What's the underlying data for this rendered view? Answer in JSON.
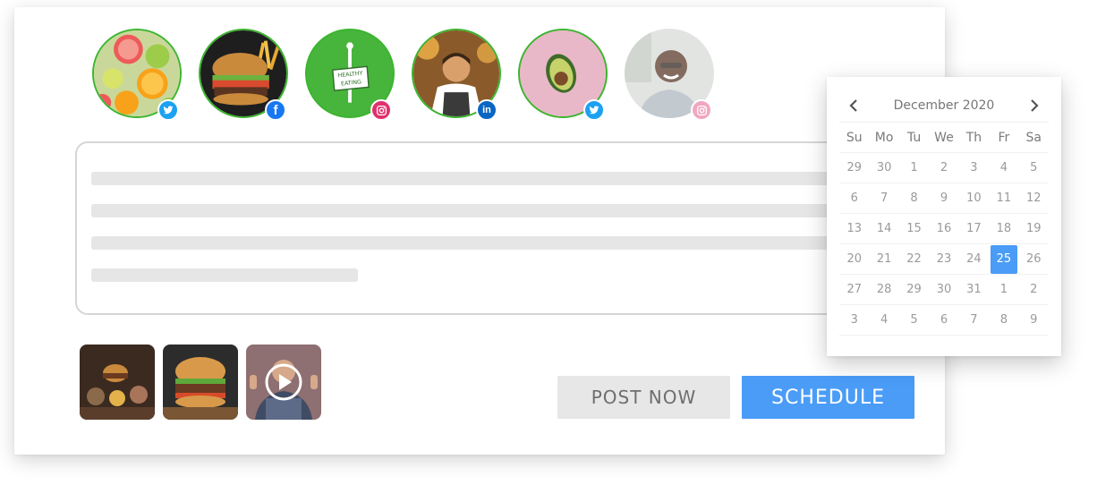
{
  "profiles": [
    {
      "subject": "citrus fruits",
      "network": "twitter-icon",
      "selected": true
    },
    {
      "subject": "burger and fries",
      "network": "facebook-icon",
      "selected": true
    },
    {
      "subject": "healthy eating logo",
      "network": "instagram-icon",
      "selected": true,
      "logo_text": "HEALTHY EATING"
    },
    {
      "subject": "chef portrait",
      "network": "linkedin-icon",
      "selected": true
    },
    {
      "subject": "avocado",
      "network": "twitter-icon",
      "selected": true
    },
    {
      "subject": "smiling man",
      "network": "instagram-icon",
      "selected": false
    }
  ],
  "media": [
    {
      "subject": "burger and fries on table"
    },
    {
      "subject": "burger close-up"
    },
    {
      "subject": "video of man giving thumbs up",
      "has_play_icon": true
    }
  ],
  "actions": {
    "post_now": "POST NOW",
    "schedule": "SCHEDULE"
  },
  "calendar": {
    "month_label": "December 2020",
    "weekdays": [
      "Su",
      "Mo",
      "Tu",
      "We",
      "Th",
      "Fr",
      "Sa"
    ],
    "weeks": [
      [
        "29",
        "30",
        "1",
        "2",
        "3",
        "4",
        "5"
      ],
      [
        "6",
        "7",
        "8",
        "9",
        "10",
        "11",
        "12"
      ],
      [
        "13",
        "14",
        "15",
        "16",
        "17",
        "18",
        "19"
      ],
      [
        "20",
        "21",
        "22",
        "23",
        "24",
        "25",
        "26"
      ],
      [
        "27",
        "28",
        "29",
        "30",
        "31",
        "1",
        "2"
      ],
      [
        "3",
        "4",
        "5",
        "6",
        "7",
        "8",
        "9"
      ]
    ],
    "selected_day": "25"
  },
  "colors": {
    "accent": "#4a9cf7",
    "selected_ring": "#3cb52f",
    "twitter": "#1da1f2",
    "facebook": "#1877f2",
    "linkedin": "#0a66c2",
    "instagram": "#e1306c"
  }
}
